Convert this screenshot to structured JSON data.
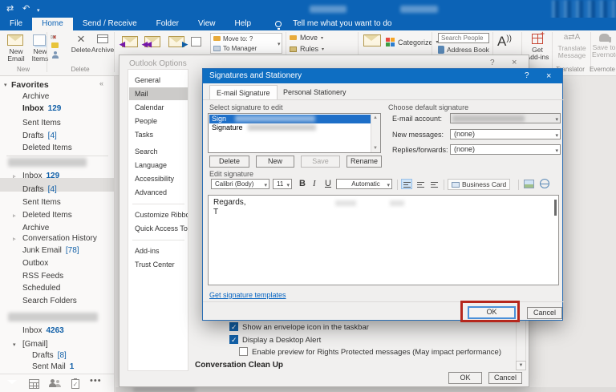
{
  "colors": {
    "titlebar": "#0c63b6",
    "accent": "#1160a8",
    "list_selection": "#1e6fc8",
    "annotation_red": "#b5271d"
  },
  "glyphs": {
    "help": "?",
    "close": "×"
  },
  "titlebar": {
    "tabs": [
      "File",
      "Home",
      "Send / Receive",
      "Folder",
      "View",
      "Help"
    ],
    "active_tab": "Home",
    "tell_me": "Tell me what you want to do"
  },
  "ribbon": {
    "new_email": "New Email",
    "new_items": "New Items",
    "group_new": "New",
    "delete_label": "Delete",
    "archive_label": "Archive",
    "group_delete": "Delete",
    "quick_steps": {
      "move_to": "Move to: ?",
      "to_manager": "To Manager"
    },
    "move": "Move",
    "rules": "Rules",
    "categorize": "Categorize",
    "search_people_placeholder": "Search People",
    "address_book": "Address Book",
    "get_addins_line1": "Get",
    "get_addins_line2": "Add-ins",
    "translate_line1": "Translate",
    "translate_line2": "Message",
    "group_translator": "Translator",
    "evernote_line1": "Save to",
    "evernote_line2": "Evernote",
    "group_evernote": "Evernote"
  },
  "sidebar": {
    "favorites_label": "Favorites",
    "favorites": [
      {
        "label": "Archive"
      },
      {
        "label": "Inbox",
        "count": "129"
      },
      {
        "label": "Sent Items"
      },
      {
        "label": "Drafts",
        "count": "[4]"
      },
      {
        "label": "Deleted Items"
      }
    ],
    "account1": [
      {
        "label": "Inbox",
        "count": "129"
      },
      {
        "label": "Drafts",
        "count": "[4]"
      },
      {
        "label": "Sent Items"
      },
      {
        "label": "Deleted Items"
      },
      {
        "label": "Archive"
      },
      {
        "label": "Conversation History"
      },
      {
        "label": "Junk Email",
        "count": "[78]"
      },
      {
        "label": "Outbox"
      },
      {
        "label": "RSS Feeds"
      },
      {
        "label": "Scheduled"
      },
      {
        "label": "Search Folders"
      }
    ],
    "account2": [
      {
        "label": "Inbox",
        "count": "4263"
      },
      {
        "label": "[Gmail]"
      },
      {
        "label": "Drafts",
        "count": "[8]"
      },
      {
        "label": "Sent Mail",
        "count": "1"
      }
    ]
  },
  "options_dialog": {
    "title": "Outlook Options",
    "nav": [
      "General",
      "Mail",
      "Calendar",
      "People",
      "Tasks",
      "Search",
      "Language",
      "Accessibility",
      "Advanced",
      "Customize Ribbon",
      "Quick Access Toolbar",
      "Add-ins",
      "Trust Center"
    ],
    "selected_nav": "Mail",
    "checkbox1": "Show an envelope icon in the taskbar",
    "checkbox2": "Display a Desktop Alert",
    "checkbox3": "Enable preview for Rights Protected messages (May impact performance)",
    "section_heading": "Conversation Clean Up",
    "ok": "OK",
    "cancel": "Cancel"
  },
  "sig_dialog": {
    "title": "Signatures and Stationery",
    "tab_email": "E-mail Signature",
    "tab_stationery": "Personal Stationery",
    "select_label": "Select signature to edit",
    "sig1": "Sign",
    "sig2": "Signature",
    "btn_delete": "Delete",
    "btn_new": "New",
    "btn_save": "Save",
    "btn_rename": "Rename",
    "choose_label": "Choose default signature",
    "field_account": "E-mail account:",
    "field_new_messages": "New messages:",
    "value_new_messages": "(none)",
    "field_replies": "Replies/forwards:",
    "value_replies": "(none)",
    "edit_label": "Edit signature",
    "font_name": "Calibri (Body)",
    "font_size": "11",
    "font_color": "Automatic",
    "business_card": "Business Card",
    "sig_line1": "Regards,",
    "sig_line2": "T",
    "templates_link": "Get signature templates",
    "ok": "OK",
    "cancel": "Cancel"
  }
}
